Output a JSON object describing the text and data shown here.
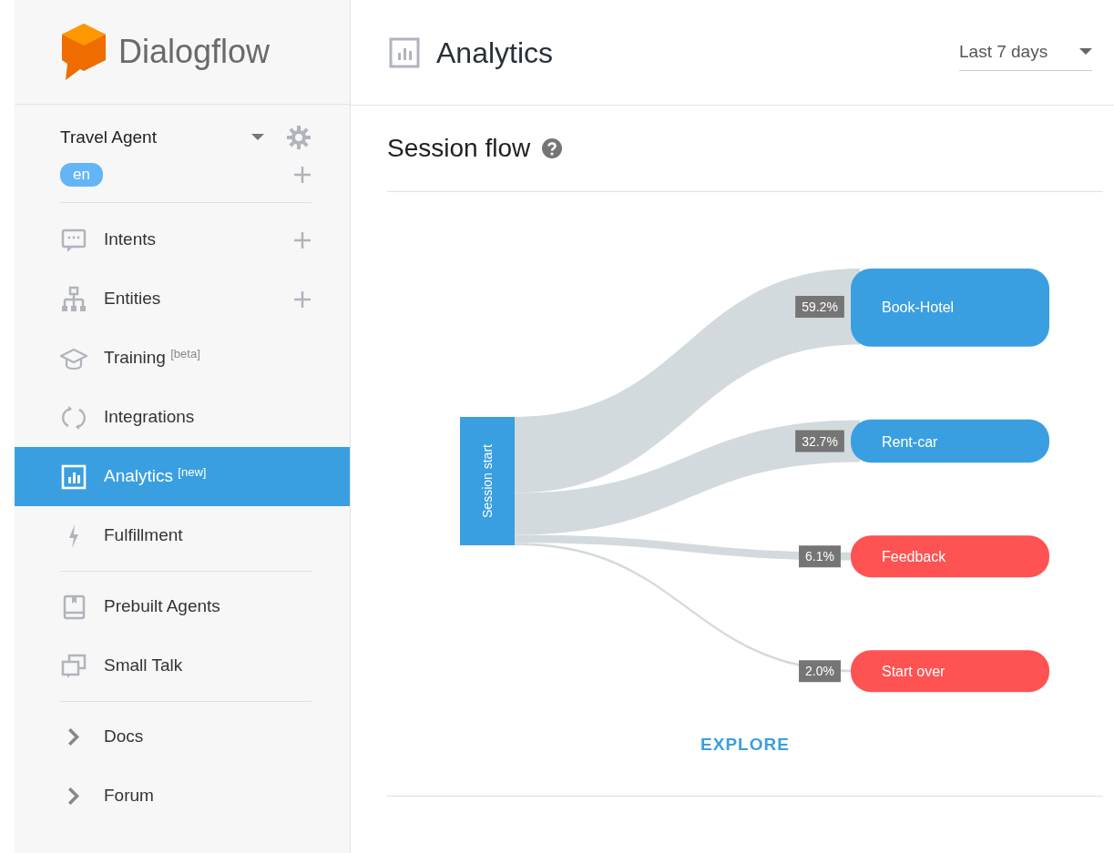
{
  "sidebar": {
    "logo_text": "Dialogflow",
    "agent": {
      "name": "Travel Agent"
    },
    "languages": [
      {
        "code": "en",
        "selected": true
      }
    ],
    "nav_groups": [
      [
        {
          "label": "Intents",
          "kind": "page",
          "add_button": true,
          "selected": false
        },
        {
          "label": "Entities",
          "kind": "page",
          "add_button": true,
          "selected": false
        },
        {
          "label": "Training",
          "sup": "[beta]",
          "kind": "page",
          "add_button": false,
          "selected": false
        },
        {
          "label": "Integrations",
          "kind": "page",
          "add_button": false,
          "selected": false
        },
        {
          "label": "Analytics",
          "sup": "[new]",
          "kind": "page",
          "add_button": false,
          "selected": true
        },
        {
          "label": "Fulfillment",
          "kind": "page",
          "add_button": false,
          "selected": false
        }
      ],
      [
        {
          "label": "Prebuilt Agents",
          "kind": "page",
          "add_button": false,
          "selected": false
        },
        {
          "label": "Small Talk",
          "kind": "page",
          "add_button": false,
          "selected": false
        }
      ],
      [
        {
          "label": "Docs",
          "kind": "link",
          "add_button": false,
          "selected": false
        },
        {
          "label": "Forum",
          "kind": "link",
          "add_button": false,
          "selected": false
        }
      ]
    ]
  },
  "header": {
    "title": "Analytics",
    "period": {
      "value": "Last 7 days"
    }
  },
  "section": {
    "title": "Session flow",
    "flow": {
      "source": {
        "label": "Session start",
        "color": "#3a9fe0"
      },
      "targets": [
        {
          "label": "Book-Hotel",
          "share": "59.2%",
          "color": "#3a9fe0"
        },
        {
          "label": "Rent-car",
          "share": "32.7%",
          "color": "#3a9fe0"
        },
        {
          "label": "Feedback",
          "share": "6.1%",
          "color": "#ff5252"
        },
        {
          "label": "Start over",
          "share": "2.0%",
          "color": "#ff5252"
        }
      ]
    },
    "action": "EXPLORE"
  }
}
